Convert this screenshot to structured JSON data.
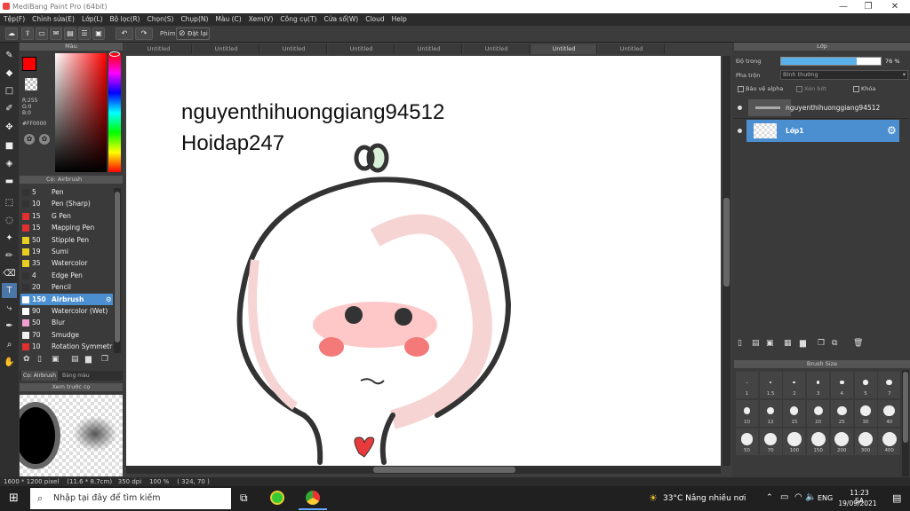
{
  "window": {
    "title": "MediBang Paint Pro (64bit)"
  },
  "menu": [
    "Tệp(F)",
    "Chỉnh sửa(E)",
    "Lớp(L)",
    "Bộ lọc(R)",
    "Chọn(S)",
    "Chụp(N)",
    "Màu (C)",
    "Xem(V)",
    "Công cụ(T)",
    "Cửa sổ(W)",
    "Cloud",
    "Help"
  ],
  "toolbar": {
    "hint": "Phím",
    "reset_label": "Đặt lại"
  },
  "color_panel": {
    "title": "Màu",
    "rgb": "R:255\nG:0\nB:0",
    "hex": "#FF0000",
    "primary": "#ff0000"
  },
  "brush_panel": {
    "title": "Cọ: Airbrush",
    "brushes": [
      {
        "size": "5",
        "name": "Pen",
        "color": "#333333"
      },
      {
        "size": "10",
        "name": "Pen (Sharp)",
        "color": "#333333"
      },
      {
        "size": "15",
        "name": "G Pen",
        "color": "#e03030"
      },
      {
        "size": "15",
        "name": "Mapping Pen",
        "color": "#e03030"
      },
      {
        "size": "50",
        "name": "Stipple Pen",
        "color": "#e8d020"
      },
      {
        "size": "19",
        "name": "Sumi",
        "color": "#e8d020"
      },
      {
        "size": "35",
        "name": "Watercolor",
        "color": "#e8d020"
      },
      {
        "size": "4",
        "name": "Edge Pen",
        "color": "#333333"
      },
      {
        "size": "20",
        "name": "Pencil",
        "color": "#333333"
      },
      {
        "size": "150",
        "name": "Airbrush",
        "color": "#ffffff"
      },
      {
        "size": "90",
        "name": "Watercolor (Wet)",
        "color": "#ffffff"
      },
      {
        "size": "50",
        "name": "Blur",
        "color": "#f0a0d0"
      },
      {
        "size": "70",
        "name": "Smudge",
        "color": "#f0f0f0"
      },
      {
        "size": "10",
        "name": "Rotation Symmetr",
        "color": "#e03030"
      }
    ],
    "tabs": [
      "Cọ: Airbrush",
      "Bảng màu"
    ]
  },
  "preview_panel": {
    "title": "Xem trước cọ"
  },
  "canvas": {
    "tabs": [
      "Untitled",
      "Untitled",
      "Untitled",
      "Untitled",
      "Untitled",
      "Untitled",
      "Untitled",
      "Untitled"
    ],
    "text_line1": "nguyenthihuonggiang94512",
    "text_line2": "Hoidap247"
  },
  "layer_panel": {
    "title": "Lớp",
    "opacity_label": "Độ trong",
    "opacity_value": "76 %",
    "opacity_fraction": 0.76,
    "blend_label": "Pha trộn",
    "blend_value": "Bình thường",
    "protect_alpha": "Bảo vệ alpha",
    "clip": "Xén bớt",
    "lock": "Khóa",
    "layers": [
      {
        "name": "nguyenthihuonggiang94512",
        "selected": false
      },
      {
        "name": "Lớp1",
        "selected": true
      }
    ]
  },
  "brush_size_panel": {
    "title": "Brush Size",
    "sizes": [
      "1",
      "1.5",
      "2",
      "3",
      "4",
      "5",
      "7",
      "10",
      "12",
      "15",
      "20",
      "25",
      "30",
      "40",
      "50",
      "70",
      "100",
      "150",
      "200",
      "300",
      "400"
    ]
  },
  "status": "1600 * 1200 pixel    (11.6 * 8.7cm)   350 dpi    100 %    ( 324, 70 )",
  "taskbar": {
    "search_placeholder": "Nhập tại đây để tìm kiếm",
    "weather": "33°C  Nắng nhiều nơi",
    "lang": "ENG",
    "time": "11:23 SA",
    "date": "19/09/2021"
  }
}
